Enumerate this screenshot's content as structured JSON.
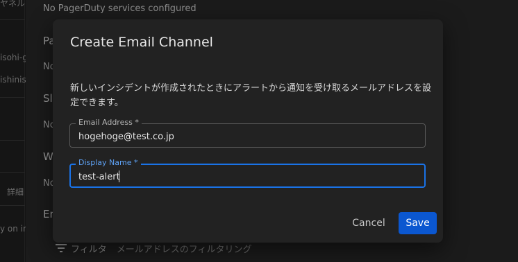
{
  "background": {
    "left_column_fragments": [
      "ヤネル",
      "isohi-g",
      "ishinishi-t",
      "詳細",
      "y on inc"
    ],
    "no_pagerduty_text": "No PagerDuty services configured",
    "section_fragments": [
      {
        "heading": "Pa",
        "status": "No"
      },
      {
        "heading": "Sla",
        "status": "No"
      },
      {
        "heading": "We",
        "status": "No"
      },
      {
        "heading": "Em",
        "status": ""
      }
    ],
    "filter": {
      "icon": "filter-list-icon",
      "label": "フィルタ",
      "placeholder": "メールアドレスのフィルタリング"
    }
  },
  "dialog": {
    "title": "Create Email Channel",
    "description": "新しいインシデントが作成されたときにアラートから通知を受け取るメールアドレスを設定できます。",
    "email_field": {
      "label": "Email Address *",
      "value": "hogehoge@test.co.jp"
    },
    "display_name_field": {
      "label": "Display Name *",
      "value": "test-alert",
      "focused": true
    },
    "buttons": {
      "cancel": "Cancel",
      "save": "Save"
    },
    "colors": {
      "accent": "#1a73e8",
      "primary_button": "#0b57d0",
      "focused_label": "#5ea2f5"
    }
  }
}
